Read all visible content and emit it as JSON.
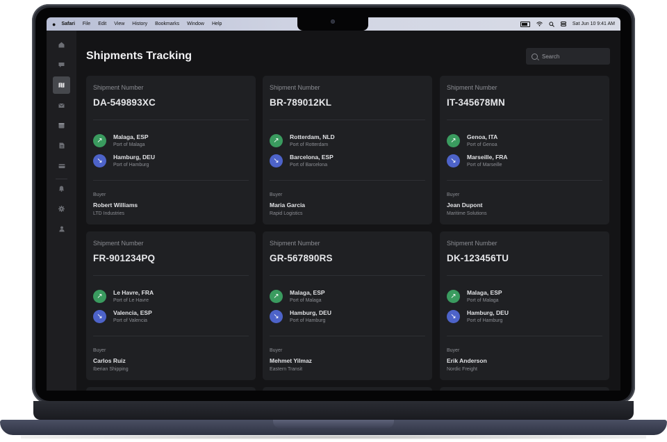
{
  "menubar": {
    "apple": "",
    "app": "Safari",
    "items": [
      "File",
      "Edit",
      "View",
      "History",
      "Bookmarks",
      "Window",
      "Help"
    ],
    "datetime": "Sat Jun 10  9:41 AM"
  },
  "sidebar": {
    "items": [
      {
        "name": "home",
        "icon": "home-icon"
      },
      {
        "name": "messages",
        "icon": "chat-icon"
      },
      {
        "name": "map",
        "icon": "map-icon",
        "active": true
      },
      {
        "name": "mail",
        "icon": "mail-icon"
      },
      {
        "name": "calendar",
        "icon": "calendar-icon"
      },
      {
        "name": "documents",
        "icon": "document-icon"
      },
      {
        "name": "payments",
        "icon": "card-icon"
      },
      {
        "name": "notifications",
        "icon": "bell-icon"
      },
      {
        "name": "settings",
        "icon": "gear-icon"
      },
      {
        "name": "profile",
        "icon": "user-icon"
      }
    ]
  },
  "page": {
    "title": "Shipments Tracking",
    "search_placeholder": "Search"
  },
  "colors": {
    "origin": "#3a9b5f",
    "destination": "#4d63c9",
    "card": "#1f2023",
    "background": "#141416"
  },
  "shipments": [
    {
      "label": "Shipment Number",
      "number": "DA-549893XC",
      "origin": {
        "city": "Malaga, ESP",
        "port": "Port of Malaga"
      },
      "destination": {
        "city": "Hamburg, DEU",
        "port": "Port of Hamburg"
      },
      "buyer_label": "Buyer",
      "buyer": "Robert Williams",
      "company": "LTD Industries"
    },
    {
      "label": "Shipment Number",
      "number": "BR-789012KL",
      "origin": {
        "city": "Rotterdam, NLD",
        "port": "Port of Rotterdam"
      },
      "destination": {
        "city": "Barcelona, ESP",
        "port": "Port of Barcelona"
      },
      "buyer_label": "Buyer",
      "buyer": "Maria Garcia",
      "company": "Rapid Logistics"
    },
    {
      "label": "Shipment Number",
      "number": "IT-345678MN",
      "origin": {
        "city": "Genoa, ITA",
        "port": "Port of Genoa"
      },
      "destination": {
        "city": "Marseille, FRA",
        "port": "Port of Marseille"
      },
      "buyer_label": "Buyer",
      "buyer": "Jean Dupont",
      "company": "Maritime Solutions"
    },
    {
      "label": "Shipment Number",
      "number": "FR-901234PQ",
      "origin": {
        "city": "Le Havre, FRA",
        "port": "Port of Le Havre"
      },
      "destination": {
        "city": "Valencia, ESP",
        "port": "Port of Valencia"
      },
      "buyer_label": "Buyer",
      "buyer": "Carlos Ruiz",
      "company": "Iberian Shipping"
    },
    {
      "label": "Shipment Number",
      "number": "GR-567890RS",
      "origin": {
        "city": "Malaga, ESP",
        "port": "Port of Malaga"
      },
      "destination": {
        "city": "Hamburg, DEU",
        "port": "Port of Hamburg"
      },
      "buyer_label": "Buyer",
      "buyer": "Mehmet Yilmaz",
      "company": "Eastern Transit"
    },
    {
      "label": "Shipment Number",
      "number": "DK-123456TU",
      "origin": {
        "city": "Malaga, ESP",
        "port": "Port of Malaga"
      },
      "destination": {
        "city": "Hamburg, DEU",
        "port": "Port of Hamburg"
      },
      "buyer_label": "Buyer",
      "buyer": "Erik Anderson",
      "company": "Nordic Freight"
    }
  ]
}
